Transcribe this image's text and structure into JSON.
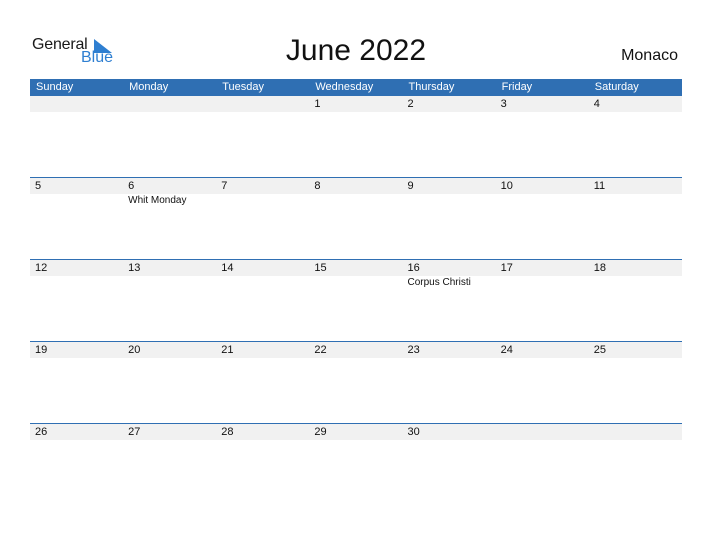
{
  "logo": {
    "general": "General",
    "blue": "Blue"
  },
  "title": "June 2022",
  "country": "Monaco",
  "weekdays": [
    "Sunday",
    "Monday",
    "Tuesday",
    "Wednesday",
    "Thursday",
    "Friday",
    "Saturday"
  ],
  "weeks": [
    {
      "days": [
        "",
        "",
        "",
        "1",
        "2",
        "3",
        "4"
      ],
      "events": [
        "",
        "",
        "",
        "",
        "",
        "",
        ""
      ]
    },
    {
      "days": [
        "5",
        "6",
        "7",
        "8",
        "9",
        "10",
        "11"
      ],
      "events": [
        "",
        "Whit Monday",
        "",
        "",
        "",
        "",
        ""
      ]
    },
    {
      "days": [
        "12",
        "13",
        "14",
        "15",
        "16",
        "17",
        "18"
      ],
      "events": [
        "",
        "",
        "",
        "",
        "Corpus Christi",
        "",
        ""
      ]
    },
    {
      "days": [
        "19",
        "20",
        "21",
        "22",
        "23",
        "24",
        "25"
      ],
      "events": [
        "",
        "",
        "",
        "",
        "",
        "",
        ""
      ]
    },
    {
      "days": [
        "26",
        "27",
        "28",
        "29",
        "30",
        "",
        ""
      ],
      "events": [
        "",
        "",
        "",
        "",
        "",
        "",
        ""
      ]
    }
  ],
  "colors": {
    "header": "#2f6fb3",
    "brand_blue": "#2f7fd1",
    "day_row": "#f1f1f1"
  }
}
